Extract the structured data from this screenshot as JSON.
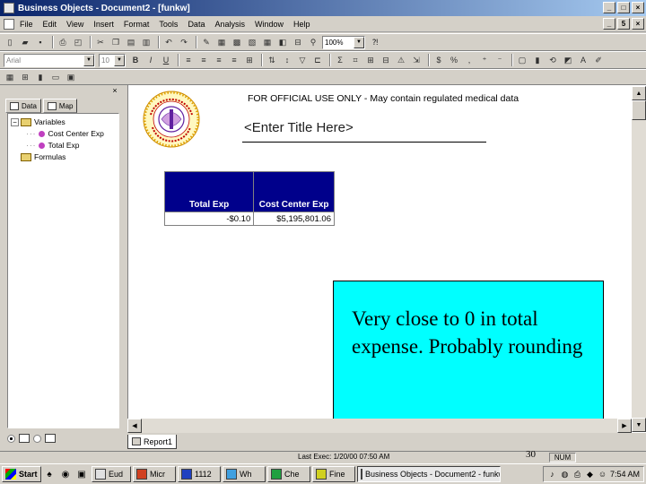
{
  "window": {
    "title": "Business Objects - Document2 - [funkw]",
    "min_label": "_",
    "max_label": "□",
    "close_label": "×"
  },
  "menu": {
    "items": [
      "File",
      "Edit",
      "View",
      "Insert",
      "Format",
      "Tools",
      "Data",
      "Analysis",
      "Window",
      "Help"
    ],
    "mdi_min": "_",
    "mdi_restore": "5",
    "mdi_close": "×"
  },
  "toolbar": {
    "zoom": "100%",
    "font_name": "Arial",
    "font_size": "10"
  },
  "left_panel": {
    "close_label": "×",
    "tabs": [
      {
        "label": "Data",
        "icon": "data-tab-icon"
      },
      {
        "label": "Map",
        "icon": "map-tab-icon"
      }
    ],
    "tree": {
      "variables_label": "Variables",
      "variables": [
        "Cost Center Exp",
        "Total Exp"
      ],
      "formulas_label": "Formulas"
    }
  },
  "report": {
    "official_note": "FOR OFFICIAL USE ONLY - May contain regulated medical data",
    "title": "<Enter Title Here>",
    "table": {
      "headers": [
        "Total Exp",
        "Cost Center Exp"
      ],
      "rows": [
        [
          "-$0.10",
          "$5,195,801.06"
        ]
      ]
    },
    "tab_label": "Report1"
  },
  "callout": {
    "text": "Very close to 0 in total expense. Probably rounding"
  },
  "status": {
    "last_exec": "Last Exec: 1/20/00 07:50 AM",
    "num": "NUM",
    "page_number": "30"
  },
  "taskbar": {
    "start_label": "Start",
    "tasks": [
      "Eud",
      "Micr",
      "1112",
      "Wh",
      "Che",
      "Fine",
      "Business Objects - Document2 - funkw"
    ],
    "clock": "7:54 AM"
  },
  "colors": {
    "table_header": "#00008b",
    "callout_bg": "#00ffff",
    "titlebar_start": "#0a246a"
  }
}
